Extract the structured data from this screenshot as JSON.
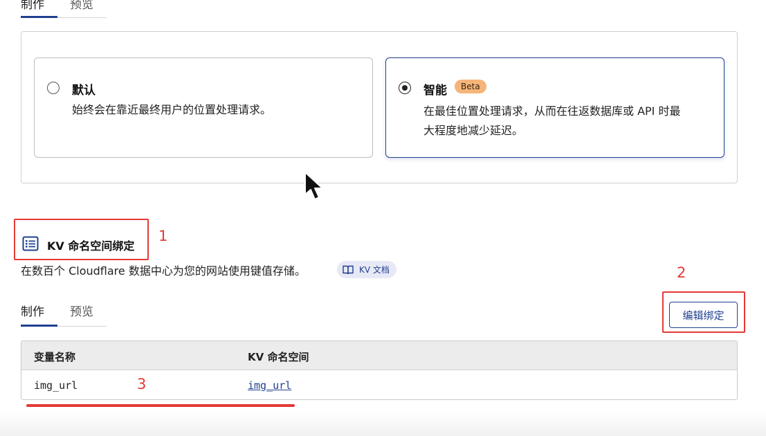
{
  "top_tabs": {
    "active": "制作",
    "inactive": "预览"
  },
  "placement": {
    "options": [
      {
        "title": "默认",
        "description": "始终会在靠近最终用户的位置处理请求。",
        "selected": false
      },
      {
        "title": "智能",
        "badge": "Beta",
        "description_line1": "在最佳位置处理请求，从而在往返数据库或 API 时最",
        "description_line2": "大程度地减少延迟。",
        "selected": true
      }
    ]
  },
  "kv_section": {
    "title": "KV 命名空间绑定",
    "description": "在数百个 Cloudflare 数据中心为您的网站使用键值存储。",
    "doc_link": "KV 文档",
    "tabs": {
      "active": "制作",
      "inactive": "预览"
    },
    "edit_button": "编辑绑定",
    "table": {
      "headers": [
        "变量名称",
        "KV 命名空间"
      ],
      "rows": [
        {
          "variable": "img_url",
          "namespace": "img_url"
        }
      ]
    }
  },
  "annotations": {
    "one": "1",
    "two": "2",
    "three": "3"
  },
  "colors": {
    "accent": "#1f3f8f",
    "annotation": "#e53935",
    "beta_badge": "#f5b57a"
  },
  "icons": [
    "list-icon",
    "book-icon",
    "cursor-icon",
    "radio-icon"
  ]
}
